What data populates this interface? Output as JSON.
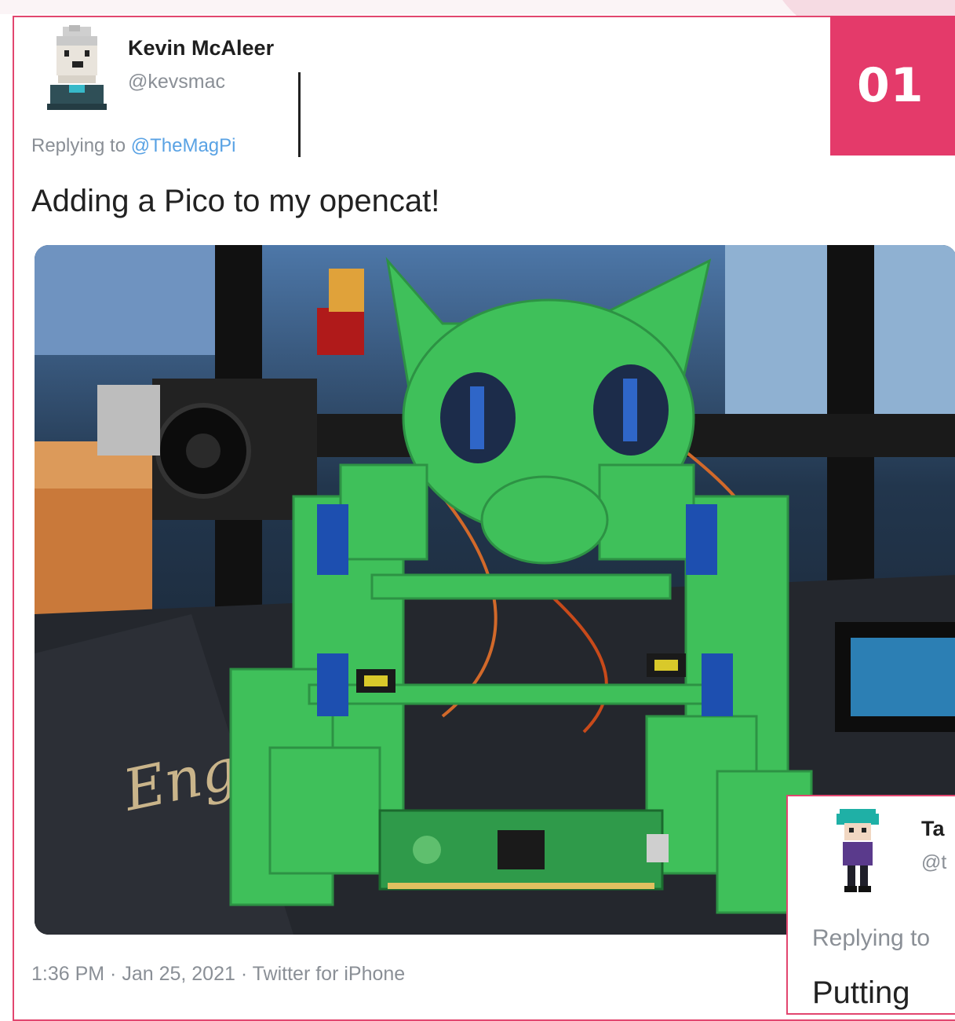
{
  "badge": {
    "number": "01"
  },
  "tweet": {
    "author_name": "Kevin McAleer",
    "handle": "@kevsmac",
    "reply_prefix": "Replying to ",
    "reply_mention": "@TheMagPi",
    "text": "Adding a Pico to my opencat!",
    "photo_caption": "Eng",
    "footer": "1:36 PM · Jan 25, 2021 · Twitter for iPhone"
  },
  "second_tweet": {
    "author_name": "Ta",
    "handle": "@t",
    "reply_prefix": "Replying to",
    "text": "Putting"
  },
  "colors": {
    "accent": "#e43a6a",
    "link": "#59a2e4",
    "muted_text": "#8a8f96",
    "robot_green": "#3fc05a"
  },
  "icons": {
    "avatar_1": "pixel-avatar-icon",
    "avatar_2": "pixel-avatar-icon"
  }
}
